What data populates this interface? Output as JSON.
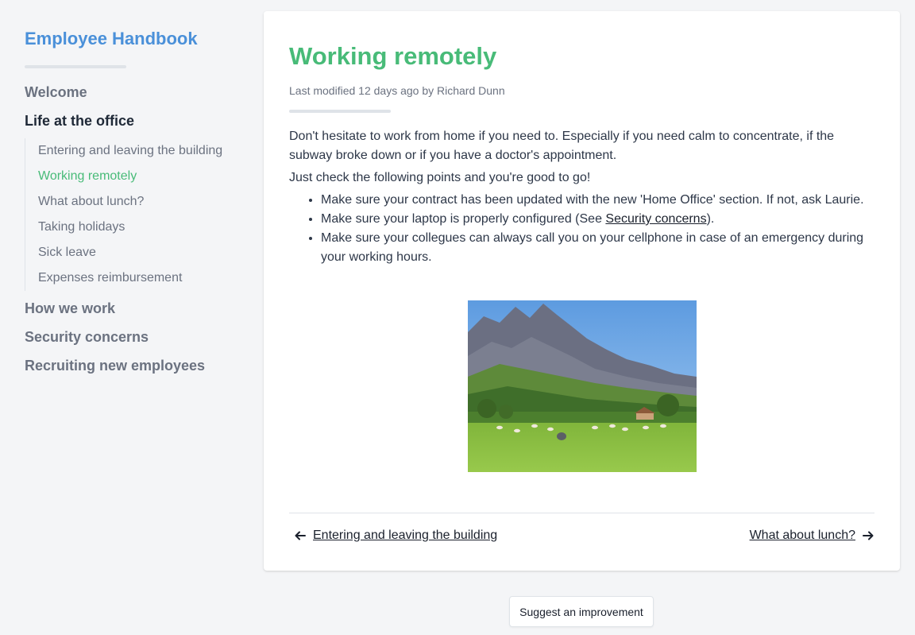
{
  "sidebar": {
    "brand": "Employee Handbook",
    "sections": [
      {
        "label": "Welcome"
      },
      {
        "label": "Life at the office",
        "active": true,
        "items": [
          {
            "label": "Entering and leaving the building"
          },
          {
            "label": "Working remotely",
            "current": true
          },
          {
            "label": "What about lunch?"
          },
          {
            "label": "Taking holidays"
          },
          {
            "label": "Sick leave"
          },
          {
            "label": "Expenses reimbursement"
          }
        ]
      },
      {
        "label": "How we work"
      },
      {
        "label": "Security concerns"
      },
      {
        "label": "Recruiting new employees"
      }
    ]
  },
  "article": {
    "title": "Working remotely",
    "meta": "Last modified 12 days ago by Richard Dunn",
    "para1": "Don't hesitate to work from home if you need to. Especially if you need calm to concentrate, if the subway broke down or if you have a doctor's appointment.",
    "para2": "Just check the following points and you're good to go!",
    "bullet1": "Make sure your contract has been updated with the new 'Home Office' section. If not, ask Laurie.",
    "bullet2_prefix": "Make sure your laptop is properly configured (See ",
    "bullet2_link": "Security concerns",
    "bullet2_suffix": ").",
    "bullet3": "Make sure your collegues can always call you on your cellphone in case of an emergency during your working hours."
  },
  "pager": {
    "prev": "Entering and leaving the building",
    "next": "What about lunch?"
  },
  "suggest_label": "Suggest an improvement",
  "colors": {
    "brand": "#4a90d9",
    "accent_green": "#48bb78",
    "background": "#f4f5f7"
  }
}
